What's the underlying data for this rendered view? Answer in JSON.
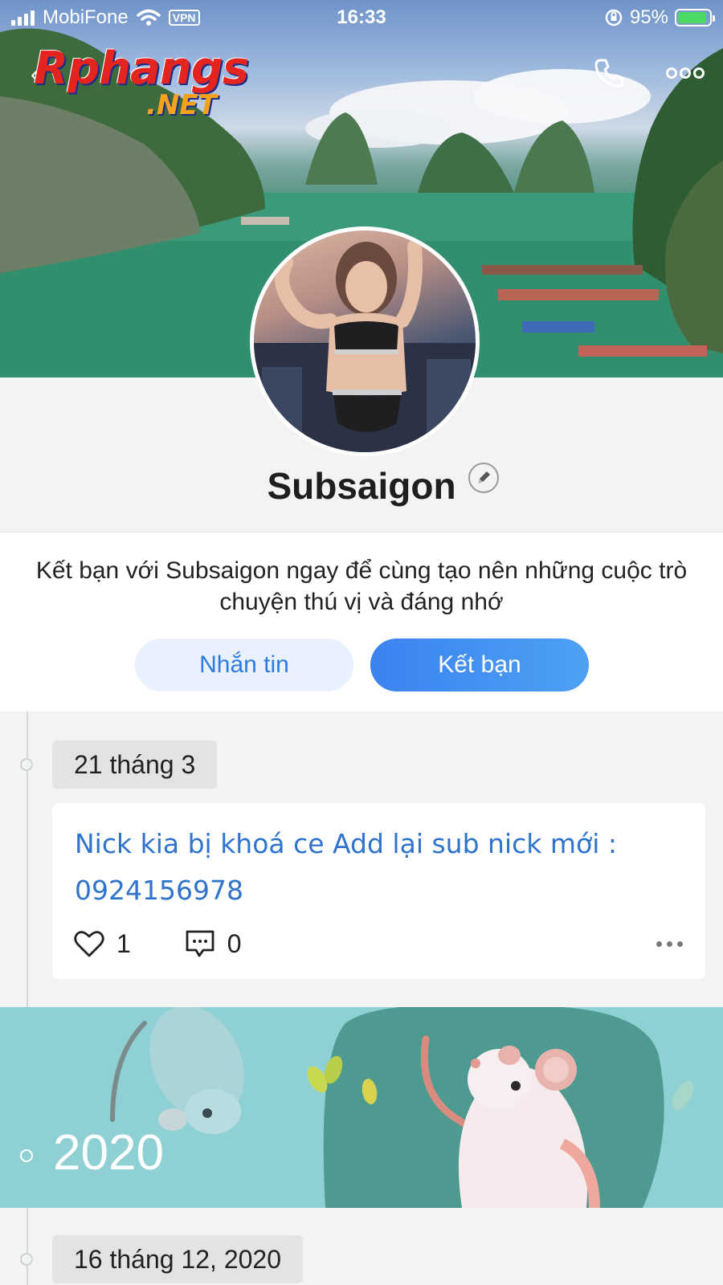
{
  "status_bar": {
    "carrier": "MobiFone",
    "vpn": "VPN",
    "time": "16:33",
    "battery": "95%"
  },
  "watermark": {
    "line1": "Rphangs",
    "line2": ".NET"
  },
  "header": {
    "back_icon": "chevron-left-icon",
    "call_icon": "phone-icon",
    "more_icon": "more-horizontal-icon"
  },
  "profile": {
    "name": "Subsaigon",
    "edit_icon": "pencil-icon"
  },
  "friend_prompt": {
    "message": "Kết bạn với Subsaigon ngay để cùng tạo nên những cuộc trò chuyện thú vị và đáng nhớ",
    "message_button": "Nhắn tin",
    "add_friend_button": "Kết bạn"
  },
  "timeline": {
    "entries": [
      {
        "date": "21 tháng 3",
        "post_text": "Nick kia bị khoá ce Add lại sub nick mới : 0924156978",
        "likes": "1",
        "comments": "0"
      }
    ],
    "year_banner": "2020",
    "next_date": "16 tháng 12, 2020"
  },
  "colors": {
    "accent_blue": "#3b82f0",
    "post_text_blue": "#2f73cc",
    "banner_teal": "#8fd0d4"
  }
}
